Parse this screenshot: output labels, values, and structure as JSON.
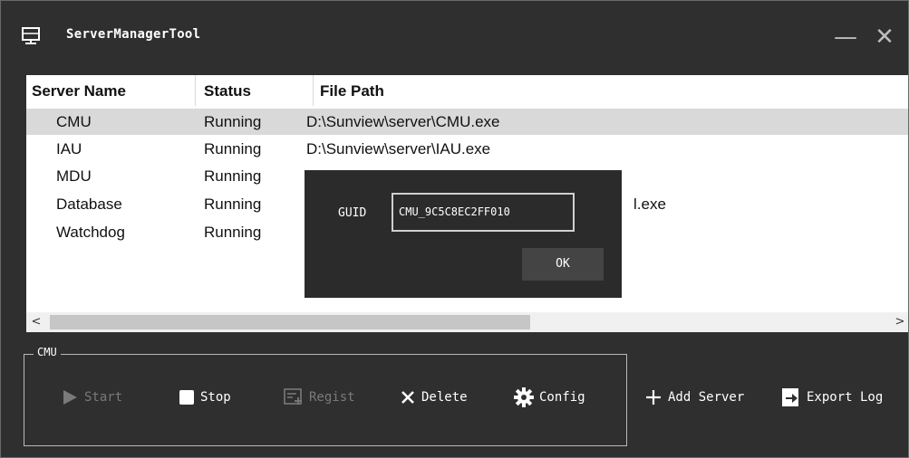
{
  "window": {
    "title": "ServerManagerTool",
    "minimize_label": "—",
    "close_label": "✕"
  },
  "list": {
    "columns": [
      "Server Name",
      "Status",
      "File Path"
    ],
    "rows": [
      {
        "name": "CMU",
        "status": "Running",
        "path": "D:\\Sunview\\server\\CMU.exe",
        "selected": true
      },
      {
        "name": "IAU",
        "status": "Running",
        "path": "D:\\Sunview\\server\\IAU.exe",
        "selected": false
      },
      {
        "name": "MDU",
        "status": "Running",
        "path": "",
        "selected": false
      },
      {
        "name": "Database",
        "status": "Running",
        "path": "l.exe",
        "selected": false
      },
      {
        "name": "Watchdog",
        "status": "Running",
        "path": "",
        "selected": false
      }
    ]
  },
  "scrollbar": {
    "left_arrow": "<",
    "right_arrow": ">"
  },
  "group": {
    "title": "CMU",
    "buttons": {
      "start": "Start",
      "stop": "Stop",
      "regist": "Regist",
      "delete": "Delete",
      "config": "Config"
    }
  },
  "actions": {
    "add_server": "Add Server",
    "export_log": "Export Log"
  },
  "dialog": {
    "guid_label": "GUID",
    "guid_value": "CMU_9C5C8EC2FF010",
    "ok_label": "OK"
  },
  "icons": {
    "app": "monitor-icon",
    "start": "play-icon",
    "stop": "stop-icon",
    "regist": "register-icon",
    "delete": "x-icon",
    "config": "gear-icon",
    "add": "plus-icon",
    "export": "export-icon"
  }
}
